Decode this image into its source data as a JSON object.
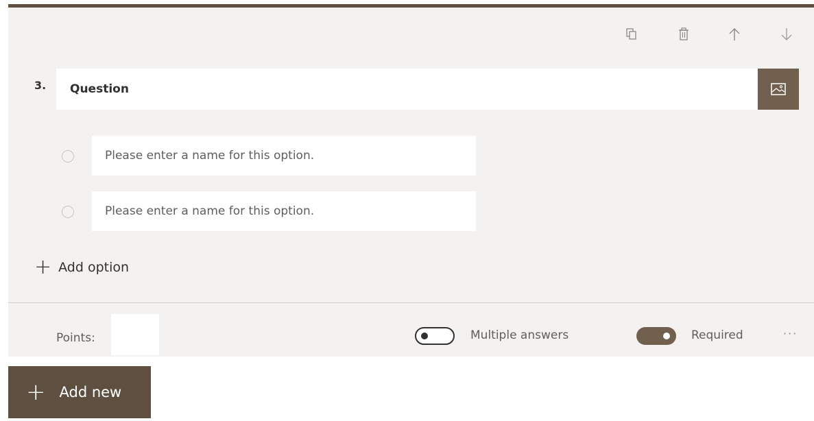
{
  "toolbar": {
    "copy_icon": "copy-icon",
    "delete_icon": "trash-icon",
    "move_up_icon": "arrow-up-icon",
    "move_down_icon": "arrow-down-icon"
  },
  "question": {
    "number": "3.",
    "title": "Question",
    "image_icon": "image-icon"
  },
  "options": [
    {
      "placeholder": "Please enter a name for this option."
    },
    {
      "placeholder": "Please enter a name for this option."
    }
  ],
  "add_option_label": "Add option",
  "footer": {
    "points_label": "Points:",
    "points_value": "",
    "multiple_answers_label": "Multiple answers",
    "multiple_answers_on": false,
    "required_label": "Required",
    "required_on": true,
    "more_label": "···"
  },
  "add_new_label": "Add new",
  "colors": {
    "accent": "#72604e",
    "accent_dark": "#5e4f40",
    "card_bg": "#f3f2f1"
  }
}
